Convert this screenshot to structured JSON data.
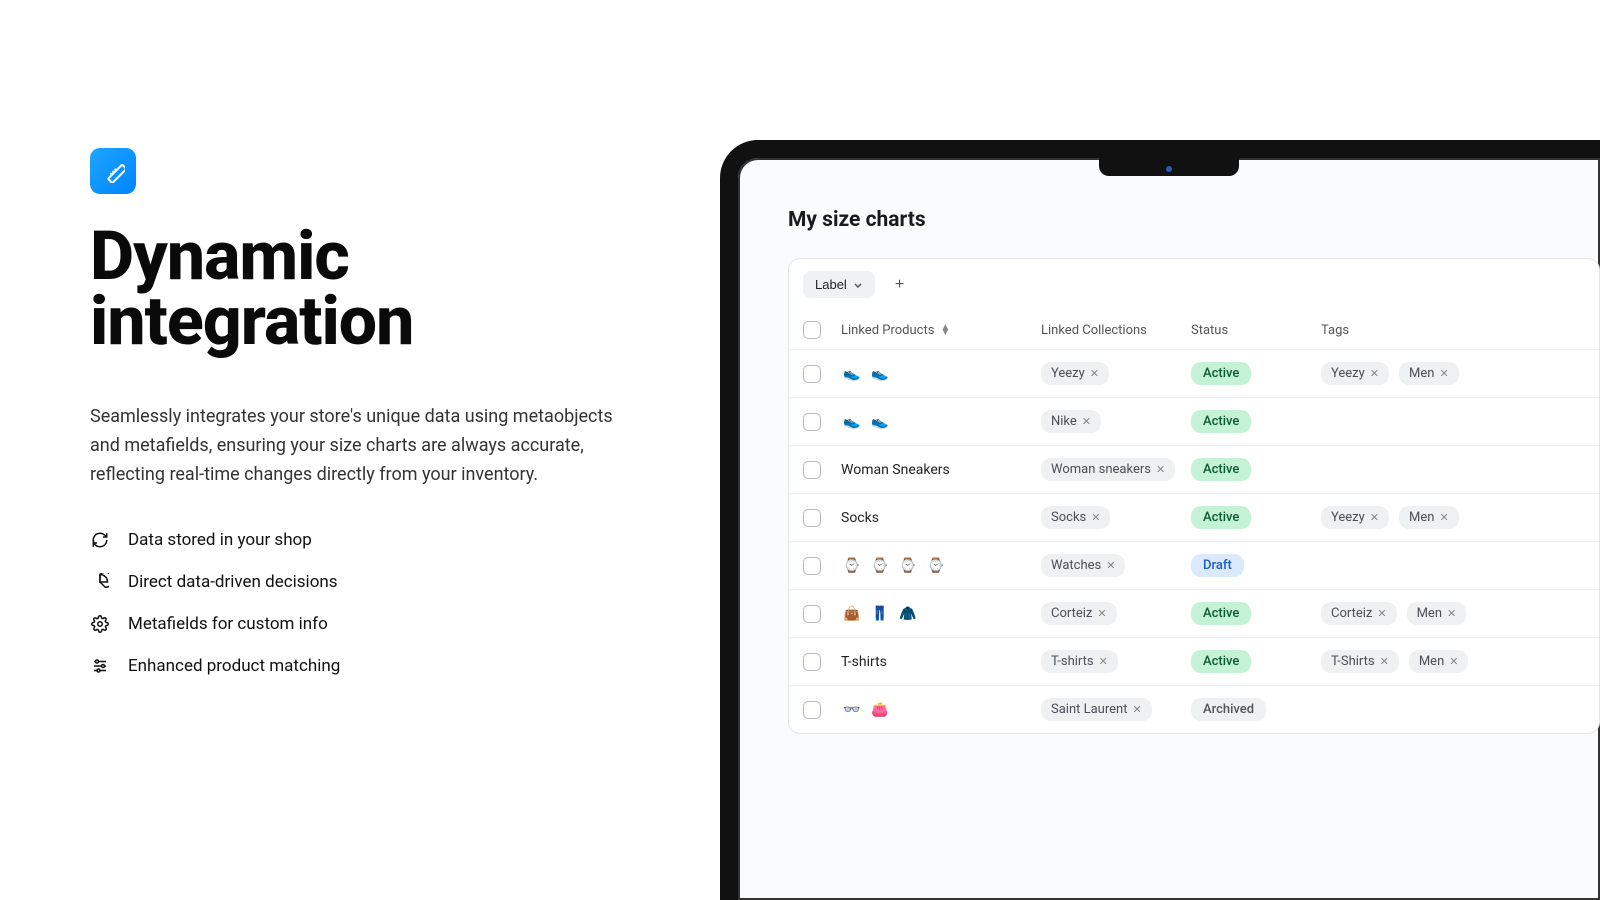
{
  "hero": {
    "title_line1": "Dynamic",
    "title_line2": "integration",
    "description": "Seamlessly integrates your store's unique data using metaobjects and metafields, ensuring your size charts are always accurate, reflecting real-time changes directly from your inventory."
  },
  "features": [
    {
      "icon": "refresh",
      "label": "Data stored in your shop"
    },
    {
      "icon": "pie",
      "label": "Direct data-driven decisions"
    },
    {
      "icon": "gear",
      "label": "Metafields for custom info"
    },
    {
      "icon": "sliders",
      "label": "Enhanced product matching"
    }
  ],
  "panel": {
    "title": "My size charts",
    "label_button": "Label",
    "columns": {
      "products": "Linked Products",
      "collections": "Linked Collections",
      "status": "Status",
      "tags": "Tags"
    }
  },
  "rows": [
    {
      "product_type": "thumbs",
      "product_label": "",
      "thumbs": [
        "👟",
        "👟"
      ],
      "collection": "Yeezy",
      "status": "Active",
      "status_class": "active",
      "tags": [
        "Yeezy",
        "Men"
      ]
    },
    {
      "product_type": "thumbs",
      "product_label": "",
      "thumbs": [
        "👟",
        "👟"
      ],
      "collection": "Nike",
      "status": "Active",
      "status_class": "active",
      "tags": []
    },
    {
      "product_type": "text",
      "product_label": "Woman Sneakers",
      "thumbs": [],
      "collection": "Woman sneakers",
      "status": "Active",
      "status_class": "active",
      "tags": []
    },
    {
      "product_type": "text",
      "product_label": "Socks",
      "thumbs": [],
      "collection": "Socks",
      "status": "Active",
      "status_class": "active",
      "tags": [
        "Yeezy",
        "Men"
      ]
    },
    {
      "product_type": "thumbs",
      "product_label": "",
      "thumbs": [
        "⌚",
        "⌚",
        "⌚",
        "⌚"
      ],
      "collection": "Watches",
      "status": "Draft",
      "status_class": "draft",
      "tags": []
    },
    {
      "product_type": "thumbs",
      "product_label": "",
      "thumbs": [
        "👜",
        "👖",
        "🧥"
      ],
      "collection": "Corteiz",
      "status": "Active",
      "status_class": "active",
      "tags": [
        "Corteiz",
        "Men"
      ]
    },
    {
      "product_type": "text",
      "product_label": "T-shirts",
      "thumbs": [],
      "collection": "T-shirts",
      "status": "Active",
      "status_class": "active",
      "tags": [
        "T-Shirts",
        "Men"
      ]
    },
    {
      "product_type": "thumbs",
      "product_label": "",
      "thumbs": [
        "👓",
        "👛"
      ],
      "collection": "Saint Laurent",
      "status": "Archived",
      "status_class": "archived",
      "tags": []
    }
  ]
}
